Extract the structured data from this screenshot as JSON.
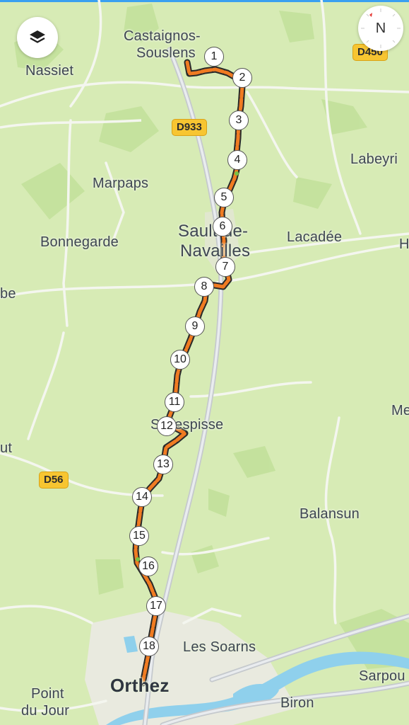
{
  "map": {
    "places": [
      {
        "name": "Castaignos-",
        "cls": ""
      },
      {
        "name": "Souslens",
        "cls": ""
      },
      {
        "name": "Nassiet",
        "cls": ""
      },
      {
        "name": "Labeyri",
        "cls": ""
      },
      {
        "name": "Marpaps",
        "cls": ""
      },
      {
        "name": "Bonnegarde",
        "cls": ""
      },
      {
        "name": "Sault-de-",
        "cls": "mid"
      },
      {
        "name": "Navailles",
        "cls": "mid"
      },
      {
        "name": "Lacadée",
        "cls": ""
      },
      {
        "name": "H",
        "cls": ""
      },
      {
        "name": "be",
        "cls": ""
      },
      {
        "name": "Me",
        "cls": ""
      },
      {
        "name": "Sallespisse",
        "cls": ""
      },
      {
        "name": "ut",
        "cls": ""
      },
      {
        "name": "Balansun",
        "cls": ""
      },
      {
        "name": "Les Soarns",
        "cls": ""
      },
      {
        "name": "Sarpou",
        "cls": ""
      },
      {
        "name": "Point",
        "cls": ""
      },
      {
        "name": "du Jour",
        "cls": ""
      },
      {
        "name": "Orthez",
        "cls": "big"
      },
      {
        "name": "Biron",
        "cls": ""
      }
    ],
    "road_shields": [
      "D450",
      "D933",
      "D56"
    ],
    "route_markers": [
      "1",
      "2",
      "3",
      "4",
      "5",
      "6",
      "7",
      "8",
      "9",
      "10",
      "11",
      "12",
      "13",
      "14",
      "15",
      "16",
      "17",
      "18"
    ],
    "route_color": "#f07b22",
    "route_outline": "#2a2a2a"
  },
  "controls": {
    "layers_button": "layers-icon",
    "compass_label": "N"
  }
}
